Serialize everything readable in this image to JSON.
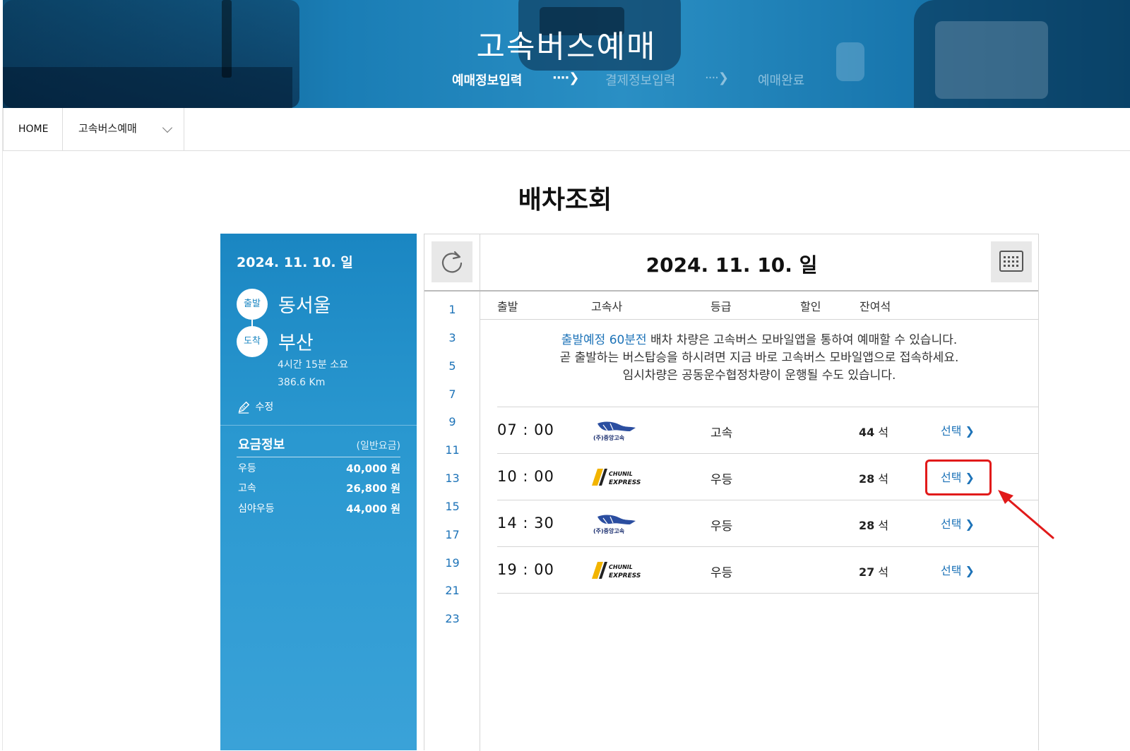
{
  "hero": {
    "title": "고속버스예매",
    "steps": [
      {
        "label": "예매정보입력",
        "state": "active"
      },
      {
        "label": "결제정보입력",
        "state": "pending"
      },
      {
        "label": "예매완료",
        "state": "pending"
      }
    ]
  },
  "nav": {
    "home": "HOME",
    "menu": "고속버스예매"
  },
  "page_title": "배차조회",
  "side": {
    "date": "2024. 11. 10. 일",
    "dep_badge": "출발",
    "dep_city": "동서울",
    "arr_badge": "도착",
    "arr_city": "부산",
    "duration": "4시간 15분 소요",
    "distance": "386.6 Km",
    "edit": "수정",
    "fare_title": "요금정보",
    "fare_type": "(일반요금)",
    "fares": [
      {
        "grade": "우등",
        "amount": "40,000 원"
      },
      {
        "grade": "고속",
        "amount": "26,800 원"
      },
      {
        "grade": "심야우등",
        "amount": "44,000 원"
      }
    ]
  },
  "main": {
    "date": "2024. 11. 10. 일",
    "hours": [
      "1",
      "3",
      "5",
      "7",
      "9",
      "11",
      "13",
      "15",
      "17",
      "19",
      "21",
      "23"
    ],
    "columns": [
      "출발",
      "고속사",
      "등급",
      "할인",
      "잔여석"
    ],
    "notice": {
      "hl": "출발예정 60분전",
      "line1_rest": " 배차 차량은 고속버스 모바일앱을 통하여 예매할 수 있습니다.",
      "line2": "곧 출발하는 버스탑승을 하시려면 지금 바로 고속버스 모바일앱으로 접속하세요.",
      "line3": "임시차량은 공동운수협정차량이 운행될 수도 있습니다."
    },
    "rows": [
      {
        "time": "07 : 00",
        "company": "(주)중앙고속",
        "logo": "jungang-logo",
        "grade": "고속",
        "seats": "44",
        "seat_unit": "석",
        "select": "선택"
      },
      {
        "time": "10 : 00",
        "company": "CHUNIL EXPRESS",
        "logo": "chunil-logo",
        "grade": "우등",
        "seats": "28",
        "seat_unit": "석",
        "select": "선택"
      },
      {
        "time": "14 : 30",
        "company": "(주)중앙고속",
        "logo": "jungang-logo",
        "grade": "우등",
        "seats": "28",
        "seat_unit": "석",
        "select": "선택"
      },
      {
        "time": "19 : 00",
        "company": "CHUNIL EXPRESS",
        "logo": "chunil-logo",
        "grade": "우등",
        "seats": "27",
        "seat_unit": "석",
        "select": "선택"
      }
    ]
  },
  "colors": {
    "accent": "#1d73b8",
    "side_panel": "#2a98d0",
    "highlight": "#e11a1a"
  }
}
